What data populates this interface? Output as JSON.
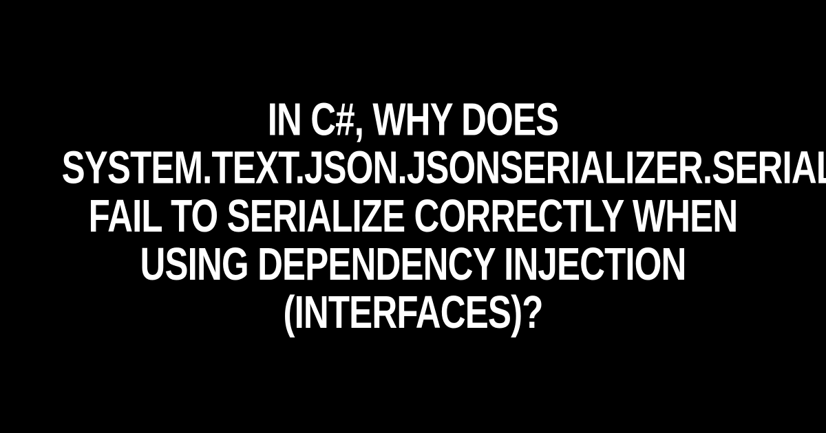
{
  "title": "In C#, why does System.Text.Json.JsonSerializer.Serialize fail to serialize correctly when using dependency injection (interfaces)?"
}
